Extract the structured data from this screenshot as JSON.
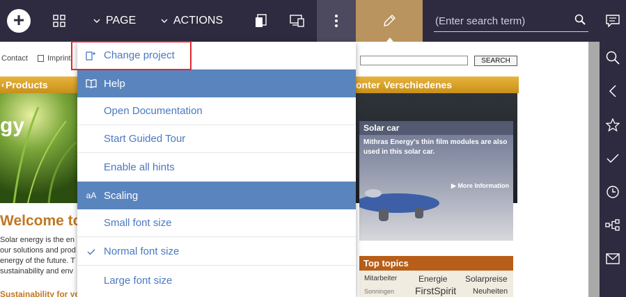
{
  "topbar": {
    "add_icon": "plus-icon",
    "grid_icon": "grid-icon",
    "page_label": "PAGE",
    "actions_label": "ACTIONS",
    "search_placeholder": "(Enter search term)",
    "colors": {
      "bar": "#2e2a3f",
      "kebab_active": "#4d4a5f",
      "edit_accent": "#b9945e"
    }
  },
  "right_rail": {
    "icons": [
      "comment-icon",
      "search-icon",
      "chevron-left-icon",
      "star-icon",
      "check-icon",
      "clock-icon",
      "workflow-icon",
      "mail-icon"
    ]
  },
  "dropdown": {
    "change_project": "Change project",
    "help_header": "Help",
    "open_documentation": "Open Documentation",
    "start_guided_tour": "Start Guided Tour",
    "enable_all_hints": "Enable all hints",
    "scaling_header": "Scaling",
    "scaling_icon_text": "aA",
    "small_font": "Small font size",
    "normal_font": "Normal font size",
    "large_font": "Large font size",
    "selected_font": "Normal font size",
    "colors": {
      "text": "#4a78c2",
      "header_bg": "#5a84bd",
      "highlight": "#e0282e"
    }
  },
  "website": {
    "contact": "Contact",
    "imprint": "Imprint",
    "search_button": "SEARCH",
    "nav_products": "Products",
    "nav_contents_fragment": "onter",
    "nav_misc": "Verschiedenes",
    "hero_text": "gy",
    "solar_car_title": "Solar car",
    "solar_car_desc": "Mithras Energy's thin film modules are also used in this solar car.",
    "more_information": "More Information",
    "welcome": "Welcome to",
    "para_lines": [
      "Solar energy is the en",
      "our solutions and prod",
      "energy of the future. T",
      "sustainability and env"
    ],
    "subhead": "Sustainability for your own four walls",
    "top_topics": "Top topics",
    "topics": [
      "Mitarbeiter",
      "Energie",
      "Solarpreise",
      "Sonningen",
      "FirstSpirit",
      "Neuheiten"
    ]
  }
}
